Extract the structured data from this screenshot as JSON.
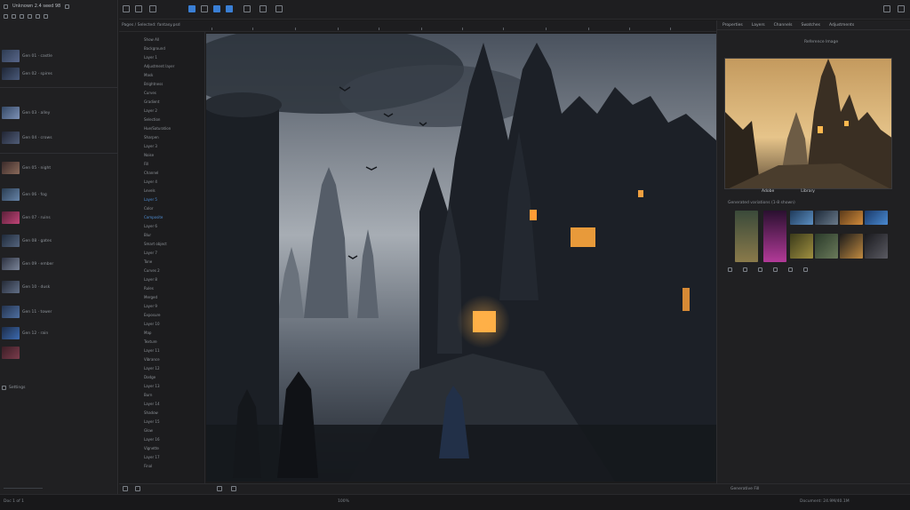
{
  "left_panel": {
    "title": "Unknown 2.4 seed 98",
    "rows": [
      {
        "label": "Gen 01 · castle"
      },
      {
        "label": "Gen 02 · spires"
      },
      {
        "label": "Gen 03 · alley"
      },
      {
        "label": "Gen 04 · crows"
      },
      {
        "label": "Gen 05 · night"
      },
      {
        "label": "Gen 06 · fog"
      },
      {
        "label": "Gen 07 · ruins"
      },
      {
        "label": "Gen 08 · gates"
      },
      {
        "label": "Gen 09 · ember"
      },
      {
        "label": "Gen 10 · dusk"
      },
      {
        "label": "Gen 11 · tower"
      },
      {
        "label": "Gen 12 · rain"
      }
    ],
    "footer_label": "Settings"
  },
  "secondary_bar": {
    "crumb": "Pages / Selected: fantasy.psd"
  },
  "list_items": [
    "Show All",
    "Background",
    "Layer 1",
    "Adjustment layer",
    "Mask",
    "Brightness",
    "Curves",
    "Gradient",
    "Layer 2",
    "Selection",
    "Hue/Saturation",
    "Sharpen",
    "Layer 3",
    "Noise",
    "Fill",
    "Channel",
    "Layer 4",
    "Levels",
    "Layer 5",
    "Color",
    "Composite",
    "Layer 6",
    "Blur",
    "Smart object",
    "Layer 7",
    "Tone",
    "Curves 2",
    "Layer 8",
    "Rules",
    "Merged",
    "Layer 9",
    "Exposure",
    "Layer 10",
    "Map",
    "Texture",
    "Layer 11",
    "Vibrance",
    "Layer 12",
    "Dodge",
    "Layer 13",
    "Burn",
    "Layer 14",
    "Shadow",
    "Layer 15",
    "Glow",
    "Layer 16",
    "Vignette",
    "Layer 17",
    "Final"
  ],
  "right_panel": {
    "tabs": [
      "Properties",
      "Layers",
      "Channels",
      "Swatches",
      "Adjustments"
    ],
    "preview_title": "Reference Image",
    "toggle": [
      "Adobe",
      "Library"
    ],
    "variations_label": "Generated variations (1-8 shown)",
    "footer": "Generative Fill"
  },
  "status": {
    "zoom": "100%",
    "info": "Document: 24.9M/40.1M",
    "left": "Doc 1 of 1"
  },
  "colors": {
    "accent": "#3a7fd5",
    "panel": "#202022",
    "canvas_bg": "#1b1b1c"
  }
}
